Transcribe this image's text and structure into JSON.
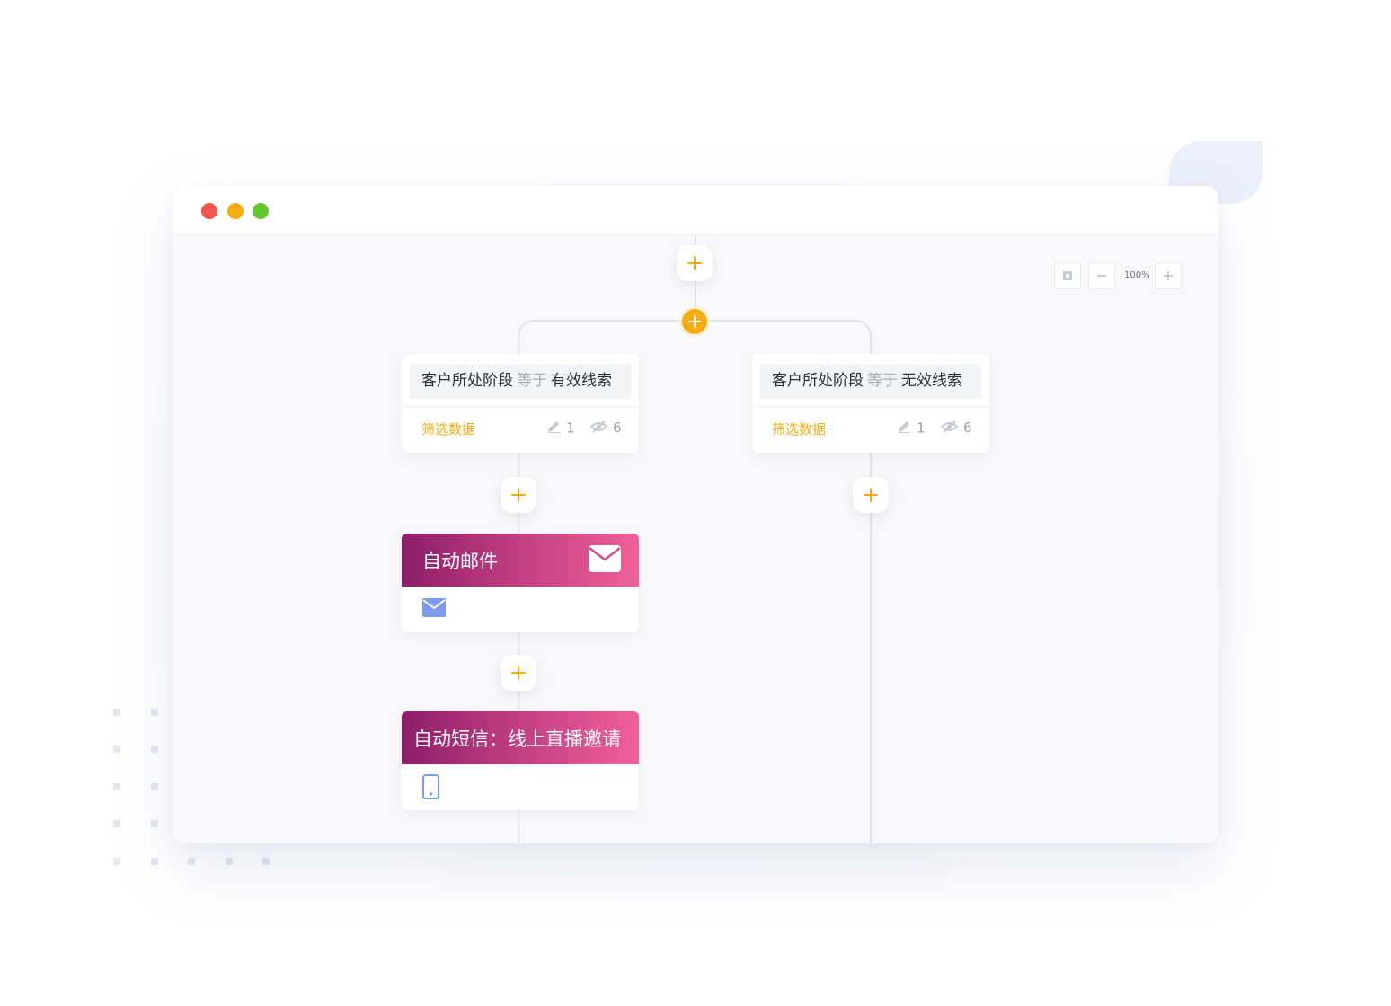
{
  "window": {
    "controls": {
      "close_color": "#f2564d",
      "minimize_color": "#f5ac12",
      "maximize_color": "#62c72d"
    }
  },
  "zoom": {
    "level_label": "100%"
  },
  "colors": {
    "accent": "#f5ac12",
    "action_gradient": [
      "#8c1e69",
      "#c33f82",
      "#f0609a"
    ],
    "icon_blue": "#7d9bf3"
  },
  "branches": [
    {
      "condition": {
        "field": "客户所处阶段",
        "operator": "等于",
        "value": "有效线索"
      },
      "filter_label": "筛选数据",
      "edit_count": "1",
      "view_count": "6"
    },
    {
      "condition": {
        "field": "客户所处阶段",
        "operator": "等于",
        "value": "无效线索"
      },
      "filter_label": "筛选数据",
      "edit_count": "1",
      "view_count": "6"
    }
  ],
  "actions": [
    {
      "title": "自动邮件",
      "icon": "mail-icon"
    },
    {
      "title": "自动短信：线上直播邀请",
      "icon": "phone-icon"
    }
  ]
}
